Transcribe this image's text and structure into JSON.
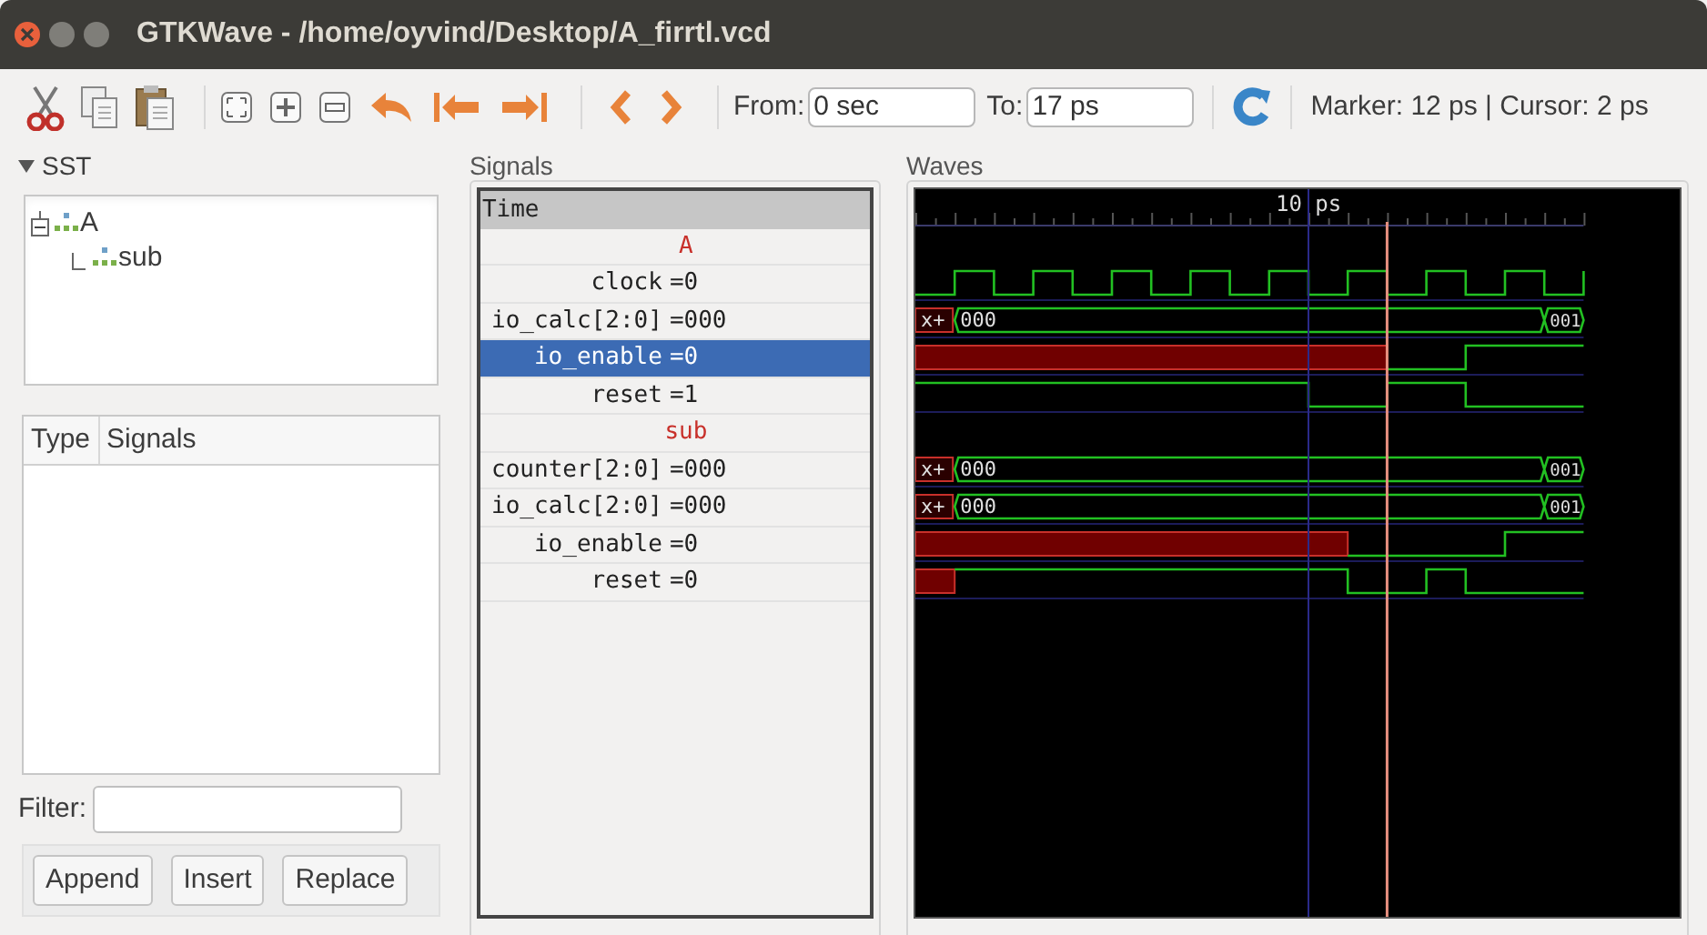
{
  "window": {
    "title": "GTKWave - /home/oyvind/Desktop/A_firrtl.vcd"
  },
  "toolbar": {
    "from": {
      "label": "From:",
      "value": "0 sec"
    },
    "to": {
      "label": "To:",
      "value": "17 ps"
    },
    "status": "Marker: 12 ps | Cursor: 2 ps"
  },
  "sst": {
    "title": "SST",
    "expanded": true,
    "tree": [
      {
        "label": "A",
        "expanded": true,
        "children": [
          {
            "label": "sub"
          }
        ]
      }
    ],
    "columns": [
      "Type",
      "Signals"
    ],
    "filter": {
      "label": "Filter:"
    },
    "buttons": [
      "Append",
      "Insert",
      "Replace"
    ]
  },
  "signals": {
    "title": "Signals",
    "rows": [
      {
        "kind": "header",
        "label": "Time"
      },
      {
        "kind": "group",
        "label": "A"
      },
      {
        "kind": "signal",
        "name": "clock",
        "value": "=0",
        "selected": false
      },
      {
        "kind": "signal",
        "name": "io_calc[2:0]",
        "value": "=000",
        "selected": false,
        "wave_texts": [
          "x+",
          "000",
          "001"
        ]
      },
      {
        "kind": "signal",
        "name": "io_enable",
        "value": "=0",
        "selected": true
      },
      {
        "kind": "signal",
        "name": "reset",
        "value": "=1",
        "selected": false
      },
      {
        "kind": "group",
        "label": "sub"
      },
      {
        "kind": "signal",
        "name": "counter[2:0]",
        "value": "=000",
        "selected": false,
        "wave_texts": [
          "x+",
          "000",
          "001"
        ]
      },
      {
        "kind": "signal",
        "name": "io_calc[2:0]",
        "value": "=000",
        "selected": false,
        "wave_texts": [
          "x+",
          "000",
          "001"
        ]
      },
      {
        "kind": "signal",
        "name": "io_enable",
        "value": "=0",
        "selected": false
      },
      {
        "kind": "signal",
        "name": "reset",
        "value": "=0",
        "selected": false
      }
    ]
  },
  "waves": {
    "title": "Waves",
    "ruler_label": "10 ps"
  }
}
